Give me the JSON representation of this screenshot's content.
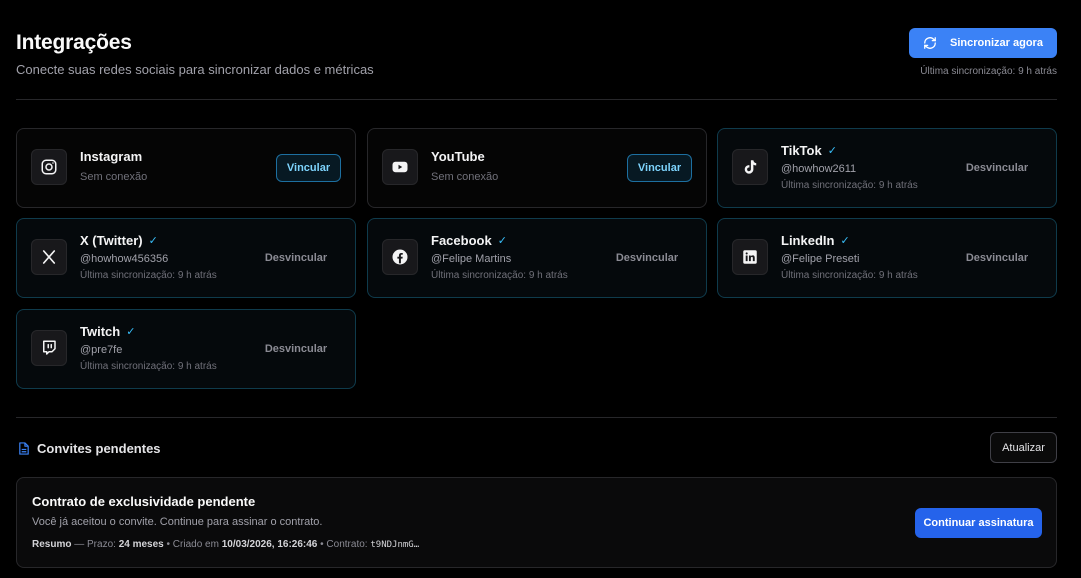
{
  "header": {
    "title": "Integrações",
    "subtitle": "Conecte suas redes sociais para sincronizar dados e métricas",
    "sync_button": "Sincronizar agora",
    "last_sync": "Última sincronização: 9 h atrás"
  },
  "integrations": [
    {
      "name": "Instagram",
      "status": "Sem conexão",
      "action": "Vincular",
      "icon": "instagram-icon"
    },
    {
      "name": "YouTube",
      "status": "Sem conexão",
      "action": "Vincular",
      "icon": "youtube-icon"
    },
    {
      "name": "TikTok",
      "handle": "@howhow2611",
      "sync": "Última sincronização: 9 h atrás",
      "action": "Desvincular",
      "icon": "tiktok-icon"
    },
    {
      "name": "X (Twitter)",
      "handle": "@howhow456356",
      "sync": "Última sincronização: 9 h atrás",
      "action": "Desvincular",
      "icon": "x-icon"
    },
    {
      "name": "Facebook",
      "handle": "@Felipe Martins",
      "sync": "Última sincronização: 9 h atrás",
      "action": "Desvincular",
      "icon": "facebook-icon"
    },
    {
      "name": "LinkedIn",
      "handle": "@Felipe Preseti",
      "sync": "Última sincronização: 9 h atrás",
      "action": "Desvincular",
      "icon": "linkedin-icon"
    },
    {
      "name": "Twitch",
      "handle": "@pre7fe",
      "sync": "Última sincronização: 9 h atrás",
      "action": "Desvincular",
      "icon": "twitch-icon"
    }
  ],
  "invites": {
    "title": "Convites pendentes",
    "refresh_button": "Atualizar",
    "contract": {
      "title": "Contrato de exclusividade pendente",
      "description": "Você já aceitou o convite. Continue para assinar o contrato.",
      "summary_label": "Resumo",
      "term_label": "— Prazo:",
      "term_value": "24 meses",
      "created_label": "• Criado em",
      "created_value": "10/03/2026, 16:26:46",
      "contract_label": "• Contrato:",
      "contract_value": "t9NDJnmG…",
      "continue_button": "Continuar assinatura"
    }
  },
  "colors": {
    "accent": "#3b82f6",
    "check": "#38bdf8",
    "link_border": "#1d6fa0",
    "connected_border": "#0f3b4c"
  }
}
